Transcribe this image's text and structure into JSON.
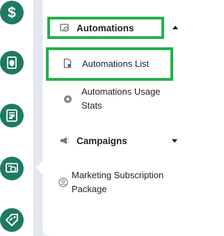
{
  "colors": {
    "rail_icon": "#1f7a63",
    "highlight": "#22b04d",
    "panel": "#ffffff"
  },
  "rail": {
    "icons": [
      "dollar-icon",
      "shield-document-icon",
      "report-icon",
      "automation-icon",
      "tag-icon"
    ]
  },
  "menu": {
    "automations": {
      "label": "Automations",
      "icon": "automation-icon",
      "expanded": true
    },
    "automations_list": {
      "label": "Automations List",
      "icon": "document-icon"
    },
    "usage_stats": {
      "line1": "Automations Usage",
      "line2": "Stats",
      "icon": "gear-icon"
    },
    "campaigns": {
      "label": "Campaigns",
      "icon": "megaphone-icon",
      "expanded": false
    },
    "marketing": {
      "line1": "Marketing Subscription",
      "line2": "Package",
      "icon": "user-circle-icon"
    }
  }
}
